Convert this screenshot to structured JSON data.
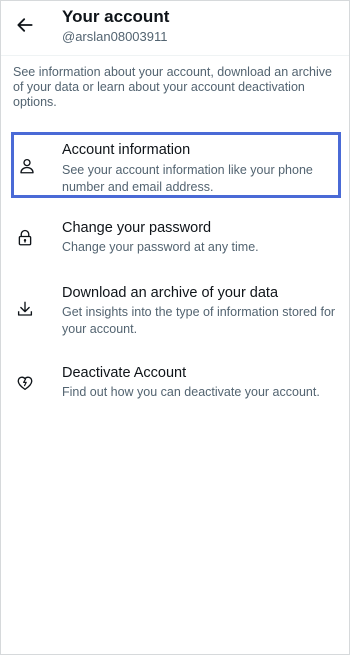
{
  "header": {
    "title": "Your account",
    "handle": "@arslan08003911",
    "back_icon": "arrow-left-icon"
  },
  "intro": "See information about your account, download an archive of your data or learn about your account deactivation options.",
  "items": [
    {
      "icon": "person-icon",
      "title": "Account information",
      "description": "See your account information like your phone number and email address.",
      "selected": true
    },
    {
      "icon": "lock-icon",
      "title": "Change your password",
      "description": "Change your password at any time.",
      "selected": false
    },
    {
      "icon": "download-icon",
      "title": "Download an archive of your data",
      "description": "Get insights into the type of information stored for your account.",
      "selected": false
    },
    {
      "icon": "broken-heart-icon",
      "title": "Deactivate Account",
      "description": "Find out how you can deactivate your account.",
      "selected": false
    }
  ],
  "colors": {
    "text_primary": "#0f1419",
    "text_secondary": "#536471",
    "selection_border": "#4a6ad6"
  }
}
